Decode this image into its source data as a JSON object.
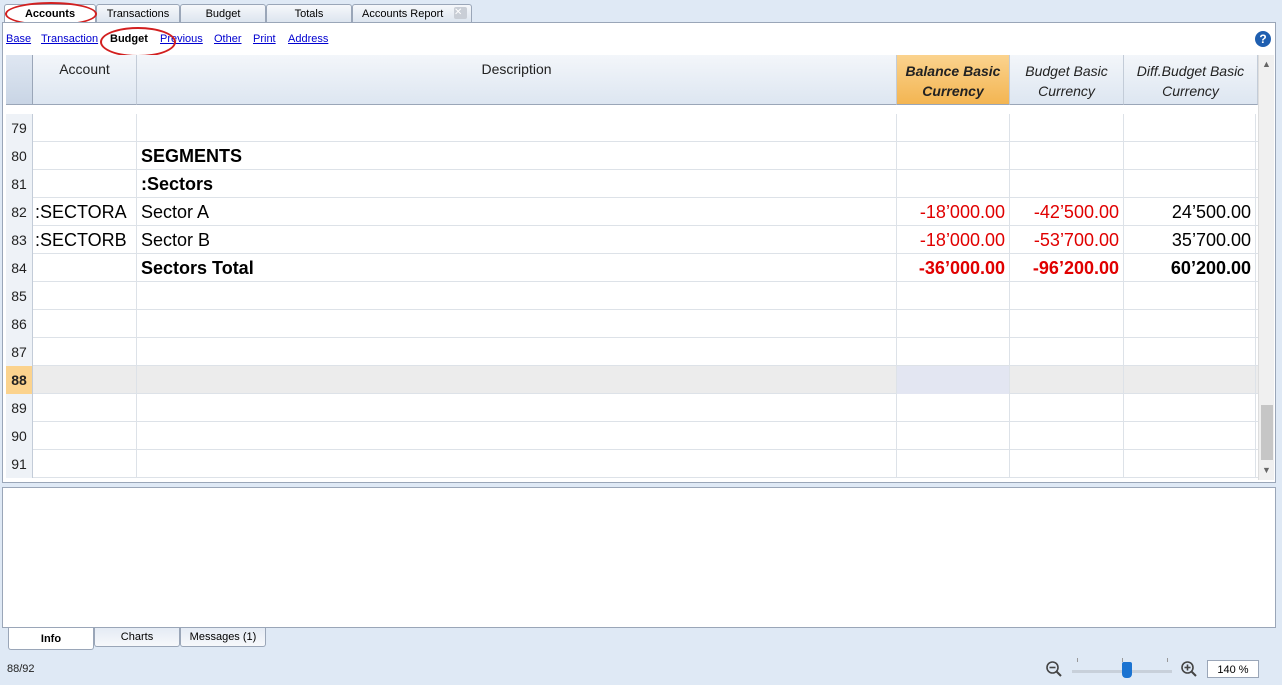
{
  "top_tabs": [
    {
      "label": "Accounts",
      "active": true
    },
    {
      "label": "Transactions"
    },
    {
      "label": "Budget"
    },
    {
      "label": "Totals"
    },
    {
      "label": "Accounts Report"
    }
  ],
  "views": [
    {
      "label": "Base"
    },
    {
      "label": "Transaction"
    },
    {
      "label": "Budget",
      "active": true
    },
    {
      "label": "Previous"
    },
    {
      "label": "Other"
    },
    {
      "label": "Print"
    },
    {
      "label": "Address"
    }
  ],
  "help_icon": "question-icon",
  "columns": {
    "account": "Account",
    "description": "Description",
    "balance_l1": "Balance Basic",
    "balance_l2": "Currency",
    "budget_l1": "Budget Basic",
    "budget_l2": "Currency",
    "diff_l1": "Diff.Budget Basic",
    "diff_l2": "Currency"
  },
  "rows": [
    {
      "n": "79",
      "account": "",
      "description": "",
      "balance": "",
      "budget": "",
      "diff": ""
    },
    {
      "n": "80",
      "account": "",
      "description": "SEGMENTS",
      "bold": true,
      "balance": "",
      "budget": "",
      "diff": ""
    },
    {
      "n": "81",
      "account": "",
      "description": ":Sectors",
      "bold": true,
      "balance": "",
      "budget": "",
      "diff": ""
    },
    {
      "n": "82",
      "account": ":SECTORA",
      "description": "Sector A",
      "balance": "-18’000.00",
      "budget": "-42’500.00",
      "diff": "24’500.00"
    },
    {
      "n": "83",
      "account": ":SECTORB",
      "description": "Sector B",
      "balance": "-18’000.00",
      "budget": "-53’700.00",
      "diff": "35’700.00"
    },
    {
      "n": "84",
      "account": "",
      "description": "Sectors Total",
      "bold": true,
      "balance": "-36’000.00",
      "budget": "-96’200.00",
      "diff": "60’200.00"
    },
    {
      "n": "85",
      "account": "",
      "description": "",
      "balance": "",
      "budget": "",
      "diff": ""
    },
    {
      "n": "86",
      "account": "",
      "description": "",
      "balance": "",
      "budget": "",
      "diff": ""
    },
    {
      "n": "87",
      "account": "",
      "description": "",
      "balance": "",
      "budget": "",
      "diff": ""
    },
    {
      "n": "88",
      "account": "",
      "description": "",
      "balance": "",
      "budget": "",
      "diff": "",
      "current": true
    },
    {
      "n": "89",
      "account": "",
      "description": "",
      "balance": "",
      "budget": "",
      "diff": ""
    },
    {
      "n": "90",
      "account": "",
      "description": "",
      "balance": "",
      "budget": "",
      "diff": ""
    },
    {
      "n": "91",
      "account": "",
      "description": "",
      "balance": "",
      "budget": "",
      "diff": ""
    }
  ],
  "bottom_tabs": [
    {
      "label": "Info",
      "active": true
    },
    {
      "label": "Charts"
    },
    {
      "label": "Messages (1)"
    }
  ],
  "status": {
    "position": "88/92",
    "zoom": "140 %",
    "zoom_level_fraction": 0.55
  },
  "colors": {
    "negative": "#e00000",
    "selected_header": "#f3b552",
    "highlight_ring": "#d21f1f"
  }
}
